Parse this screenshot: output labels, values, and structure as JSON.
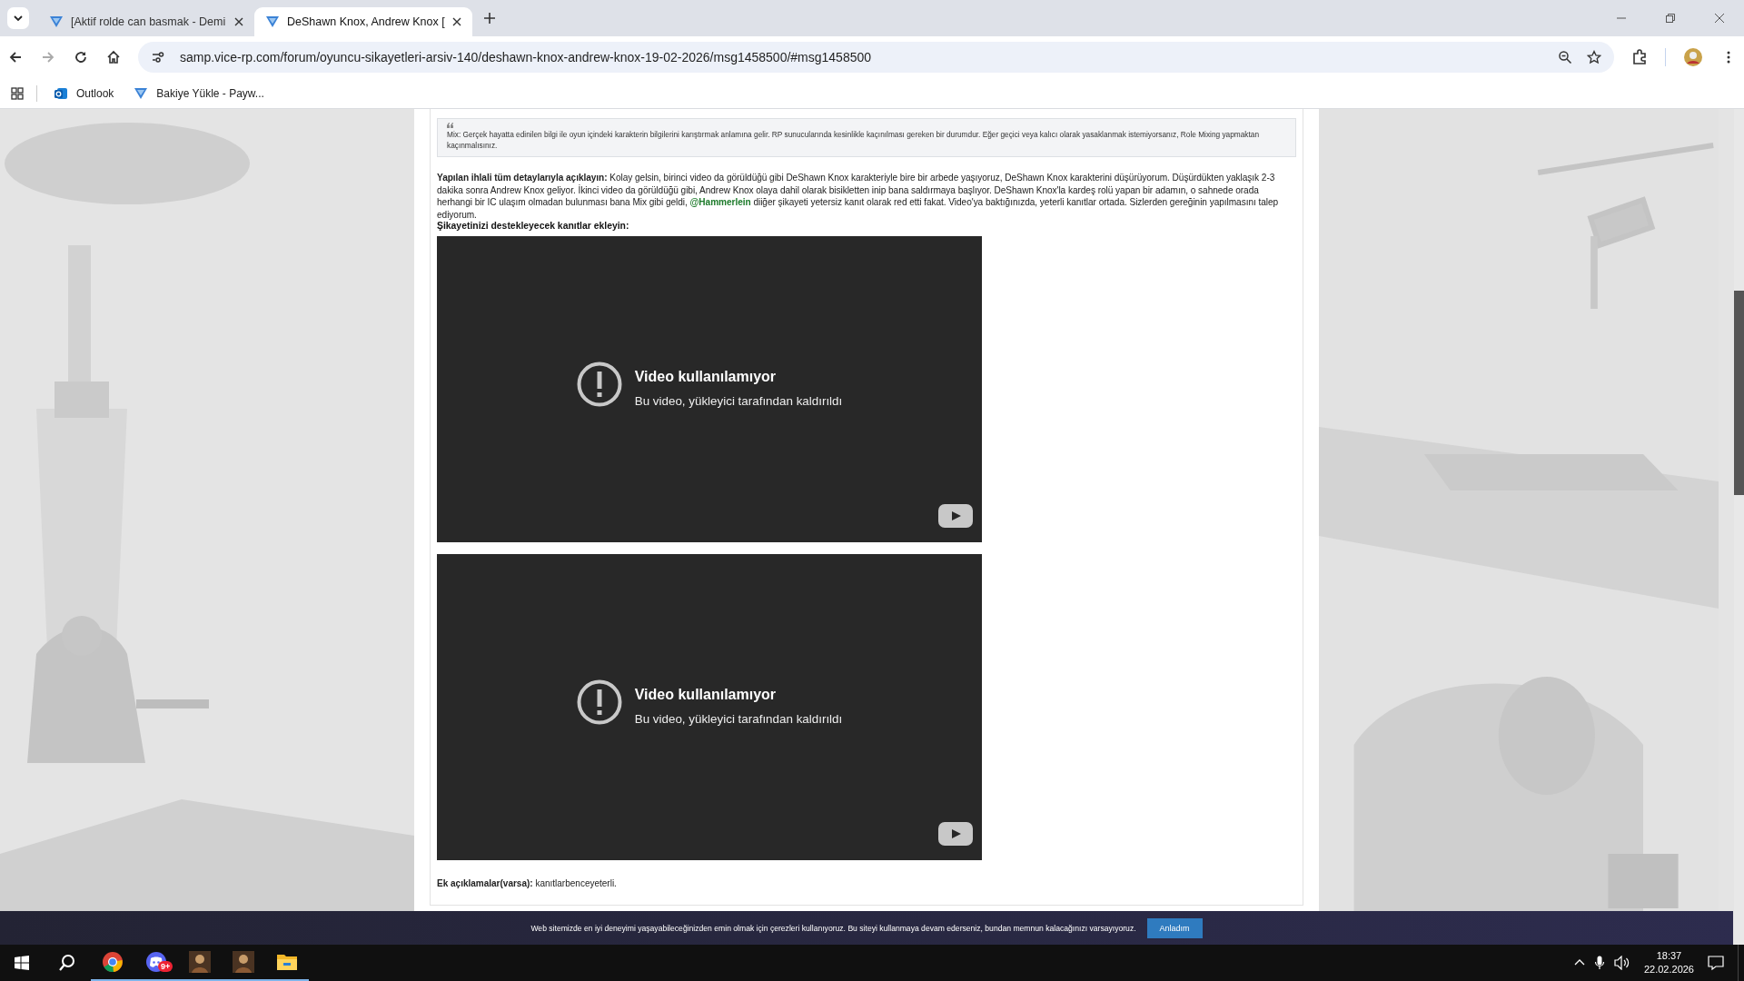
{
  "browser": {
    "tabs": [
      {
        "title": "[Aktif rolde can basmak - Demi",
        "selected": false
      },
      {
        "title": "DeShawn Knox, Andrew Knox [",
        "selected": true
      }
    ],
    "url": "samp.vice-rp.com/forum/oyuncu-sikayetleri-arsiv-140/deshawn-knox-andrew-knox-19-02-2026/msg1458500/#msg1458500",
    "bookmarks": [
      {
        "label": "Outlook",
        "kind": "outlook"
      },
      {
        "label": "Bakiye Yükle - Payw...",
        "kind": "site"
      }
    ]
  },
  "post": {
    "quote": "Mix: Gerçek hayatta edinilen bilgi ile oyun içindeki karakterin bilgilerini karıştırmak anlamına gelir. RP sunucularında kesinlikle kaçınılması gereken bir durumdur. Eğer geçici veya kalıcı olarak yasaklanmak istemiyorsanız, Role Mixing yapmaktan kaçınmalısınız.",
    "description": [
      {
        "kind": "text",
        "text": "**Yapılan ihlali tüm detaylarıyla açıklayın:** Kolay gelsin, birinci video da görüldüğü gibi DeShawn Knox karakteriyle bire bir arbede yaşıyoruz, DeShawn Knox karakterini düşürüyorum. Düşürdükten yaklaşık 2-3 dakika sonra Andrew Knox geliyor. İkinci video da görüldüğü gibi, Andrew Knox olaya dahil olarak bisikletten inip bana saldırmaya başlıyor. DeShawn Knox'la kardeş rolü yapan bir adamın, o sahnede orada herhangi bir IC ulaşım olmadan bulunması bana Mix gibi geldi, "
      },
      {
        "kind": "mention",
        "text": "@Hammerlein"
      },
      {
        "kind": "text",
        "text": " diiğer şikayeti yetersiz kanıt olarak red etti fakat. Video'ya baktığınızda, yeterli kanıtlar ortada. Sizlerden gereğinin yapılmasını talep ediyorum."
      }
    ],
    "evidence_label": "Şikayetinizi destekleyecek kanıtlar ekleyin:",
    "videos": [
      {
        "title": "Video kullanılamıyor",
        "message": "Bu video, yükleyici tarafından kaldırıldı"
      },
      {
        "title": "Video kullanılamıyor",
        "message": "Bu video, yükleyici tarafından kaldırıldı"
      }
    ],
    "extra": {
      "label": "Ek açıklamalar(varsa):",
      "value": "kanıtlarbenceyeterli."
    }
  },
  "cookie_notice": {
    "text": "Web sitemizde en iyi deneyimi yaşayabileceğinizden emin olmak için çerezleri kullanıyoruz. Bu siteyi kullanmaya devam ederseniz, bundan memnun kalacağınızı varsayıyoruz.",
    "button": "Anladım"
  },
  "taskbar": {
    "apps": [
      {
        "kind": "chrome",
        "running": true
      },
      {
        "kind": "discord",
        "running": true,
        "badge": "9+"
      },
      {
        "kind": "game",
        "running": true
      },
      {
        "kind": "game",
        "running": true
      },
      {
        "kind": "explorer",
        "running": true
      }
    ],
    "time": "18:37",
    "date": "22.02.2026"
  }
}
